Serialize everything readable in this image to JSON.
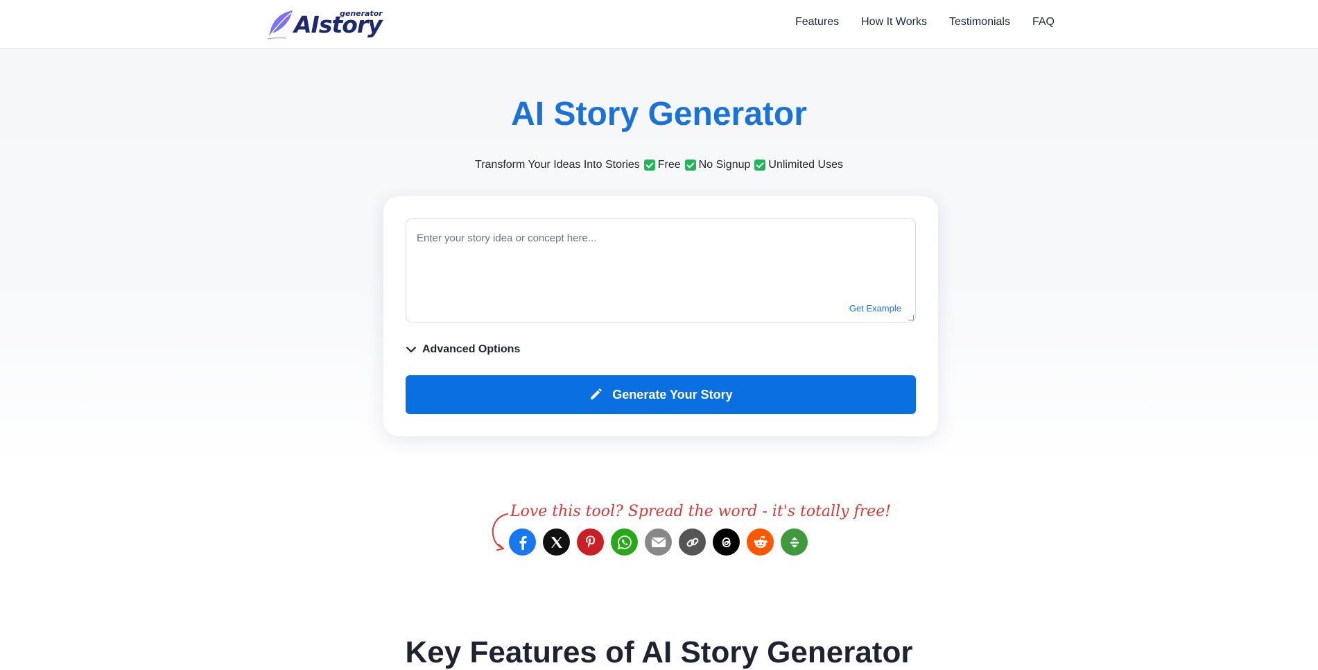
{
  "nav": {
    "logo_text": "AIstory",
    "logo_sub": "generator",
    "links": [
      "Features",
      "How It Works",
      "Testimonials",
      "FAQ"
    ]
  },
  "hero": {
    "title": "AI Story Generator",
    "subtitle": "Transform Your Ideas Into Stories",
    "badges": [
      "Free",
      "No Signup",
      "Unlimited Uses"
    ]
  },
  "form": {
    "placeholder": "Enter your story idea or concept here...",
    "get_example": "Get Example",
    "advanced_label": "Advanced Options",
    "generate_label": "Generate Your Story"
  },
  "share": {
    "text": "Love this tool? Spread the word - it's totally free!",
    "buttons": [
      {
        "name": "facebook",
        "icon": "facebook-icon",
        "color": "#1877f2"
      },
      {
        "name": "x",
        "icon": "x-icon",
        "color": "#111111"
      },
      {
        "name": "pinterest",
        "icon": "pinterest-icon",
        "color": "#cb1f27"
      },
      {
        "name": "whatsapp",
        "icon": "whatsapp-icon",
        "color": "#29a71a"
      },
      {
        "name": "email",
        "icon": "email-icon",
        "color": "#888888"
      },
      {
        "name": "copy-link",
        "icon": "link-icon",
        "color": "#555555"
      },
      {
        "name": "threads",
        "icon": "threads-icon",
        "color": "#000000"
      },
      {
        "name": "reddit",
        "icon": "reddit-icon",
        "color": "#ff5700"
      },
      {
        "name": "more",
        "icon": "more-icon",
        "color": "#3f9a3d"
      }
    ]
  },
  "features": {
    "heading": "Key Features of AI Story Generator"
  },
  "colors": {
    "accent": "#1a72d8",
    "button": "#0a6fe0",
    "check": "#21b45a",
    "share_text": "#d33a3a"
  }
}
